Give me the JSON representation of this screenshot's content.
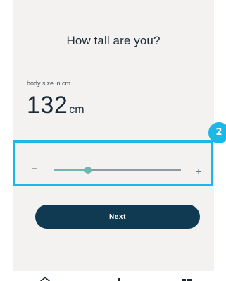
{
  "screen": {
    "question": "How tall are you?",
    "size_label": "body size in cm",
    "size_value": "132",
    "size_unit": "cm"
  },
  "slider": {
    "minus_label": "−",
    "plus_label": "+",
    "level_fraction": 0.27
  },
  "highlight": {
    "step_number": "2",
    "accent_color": "#1bb7e8"
  },
  "next_button": {
    "label": "Next",
    "color": "#0f3a52"
  },
  "bottom_nav": {
    "icons": [
      "home-icon",
      "person-icon",
      "grid-icon"
    ]
  }
}
